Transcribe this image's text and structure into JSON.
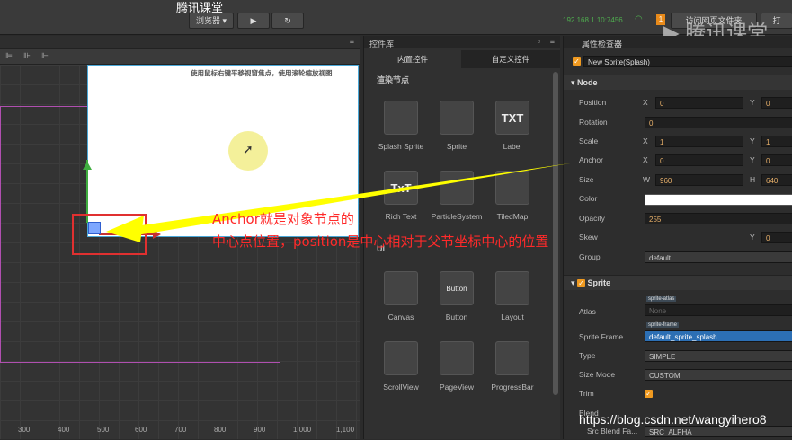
{
  "topbar": {
    "title": "腾讯课堂",
    "browser_label": "浏览器",
    "ip": "192.168.1.10:7456",
    "badge": "1",
    "visit_label": "访问网页文件夹",
    "extra_label": "打"
  },
  "watermark": "腾讯课堂",
  "scene": {
    "hint": "使用鼠标右键平移视窗焦点，使用滚轮缩放视图",
    "ruler": [
      "300",
      "400",
      "500",
      "600",
      "700",
      "800",
      "900",
      "1,000",
      "1,100"
    ]
  },
  "library": {
    "title": "控件库",
    "tab_builtin": "内置控件",
    "tab_custom": "自定义控件",
    "section_render": "渲染节点",
    "section_ui": "UI",
    "render_items": [
      {
        "label": "Splash Sprite",
        "icon": "splash-sprite-icon"
      },
      {
        "label": "Sprite",
        "icon": "sprite-icon"
      },
      {
        "label": "Label",
        "icon": "label-icon",
        "glyph": "TXT"
      },
      {
        "label": "Rich Text",
        "icon": "rich-text-icon",
        "glyph": "TxT"
      },
      {
        "label": "ParticleSystem",
        "icon": "particle-icon"
      },
      {
        "label": "TiledMap",
        "icon": "tiledmap-icon"
      }
    ],
    "ui_items": [
      {
        "label": "Canvas",
        "icon": "canvas-icon"
      },
      {
        "label": "Button",
        "icon": "button-icon",
        "glyph": "Button"
      },
      {
        "label": "Layout",
        "icon": "layout-icon"
      },
      {
        "label": "ScrollView",
        "icon": "scrollview-icon"
      },
      {
        "label": "PageView",
        "icon": "pageview-icon"
      },
      {
        "label": "ProgressBar",
        "icon": "progressbar-icon"
      }
    ]
  },
  "inspector": {
    "title": "属性检查器",
    "node_name": "New Sprite(Splash)",
    "node_header": "Node",
    "position": {
      "label": "Position",
      "x": "0",
      "y": "0"
    },
    "rotation": {
      "label": "Rotation",
      "v": "0"
    },
    "scale": {
      "label": "Scale",
      "x": "1",
      "y": "1"
    },
    "anchor": {
      "label": "Anchor",
      "x": "0",
      "y": "0"
    },
    "size": {
      "label": "Size",
      "w": "960",
      "h": "640"
    },
    "color": {
      "label": "Color",
      "value": "#ffffff"
    },
    "opacity": {
      "label": "Opacity",
      "v": "255"
    },
    "skew": {
      "label": "Skew",
      "y": "0"
    },
    "group": {
      "label": "Group",
      "v": "default"
    },
    "sprite_header": "Sprite",
    "atlas": {
      "label": "Atlas",
      "tag": "sprite-atlas",
      "v": "None"
    },
    "sprite_frame": {
      "label": "Sprite Frame",
      "tag": "sprite-frame",
      "v": "default_sprite_splash"
    },
    "type": {
      "label": "Type",
      "v": "SIMPLE"
    },
    "size_mode": {
      "label": "Size Mode",
      "v": "CUSTOM"
    },
    "trim": {
      "label": "Trim"
    },
    "blend": {
      "label": "Blend"
    },
    "src_blend": {
      "label": "Src Blend Fa...",
      "v": "SRC_ALPHA"
    },
    "axis": {
      "x": "X",
      "y": "Y",
      "w": "W",
      "h": "H"
    }
  },
  "annotation": {
    "line1": "Anchor就是对象节点的",
    "line2": "中心点位置，position是中心相对于父节坐标中心的位置",
    "color": "#ff2a2a",
    "arrow_color": "#ffff00"
  },
  "credit": "https://blog.csdn.net/wangyihero8"
}
